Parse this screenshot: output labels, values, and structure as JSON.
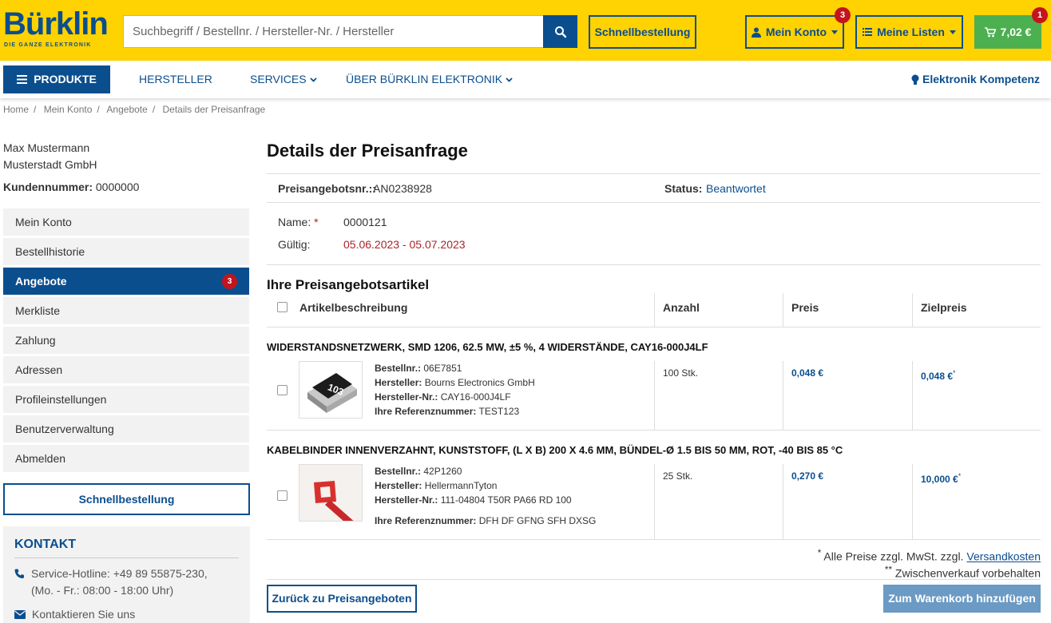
{
  "header": {
    "logo_text": "Bürklin",
    "logo_tagline": "DIE GANZE ELEKTRONIK",
    "search_placeholder": "Suchbegriff / Bestellnr. / Hersteller-Nr. / Hersteller",
    "quick_order": "Schnellbestellung",
    "account": "Mein Konto",
    "account_badge": "3",
    "lists": "Meine Listen",
    "cart_total": "7,02 €",
    "cart_badge": "1"
  },
  "nav": {
    "products": "PRODUKTE",
    "manufacturers": "HERSTELLER",
    "services": "SERVICES",
    "about": "ÜBER BÜRKLIN ELEKTRONIK",
    "competence": "Elektronik Kompetenz"
  },
  "breadcrumb": [
    "Home",
    "Mein Konto",
    "Angebote",
    "Details der Preisanfrage"
  ],
  "sidebar": {
    "name": "Max Mustermann",
    "company": "Musterstadt GmbH",
    "customer_label": "Kundennummer:",
    "customer_number": "0000000",
    "items": [
      {
        "label": "Mein Konto"
      },
      {
        "label": "Bestellhistorie"
      },
      {
        "label": "Angebote",
        "count": "3"
      },
      {
        "label": "Merkliste"
      },
      {
        "label": "Zahlung"
      },
      {
        "label": "Adressen"
      },
      {
        "label": "Profileinstellungen"
      },
      {
        "label": "Benutzerverwaltung"
      },
      {
        "label": "Abmelden"
      }
    ],
    "quick_order": "Schnellbestellung",
    "contact_title": "KONTAKT",
    "hotline": "Service-Hotline: +49 89 55875-230,",
    "hours": "(Mo. - Fr.: 08:00 - 18:00 Uhr)",
    "contact_link": "Kontaktieren Sie uns"
  },
  "main": {
    "title": "Details der Preisanfrage",
    "offer_label": "Preisangebotsnr.::",
    "offer_number": "AN0238928",
    "status_label": "Status:",
    "status_value": "Beantwortet",
    "name_label": "Name:",
    "name_required": "*",
    "name_value": "0000121",
    "valid_label": "Gültig:",
    "valid_value": "05.06.2023 - 05.07.2023",
    "items_title": "Ihre Preisangebotsartikel",
    "columns": {
      "desc": "Artikelbeschreibung",
      "qty": "Anzahl",
      "price": "Preis",
      "target": "Zielpreis"
    },
    "products": [
      {
        "title": "WIDERSTANDSNETZWERK, SMD 1206, 62.5 MW, ±5 %, 4 WIDERSTÄNDE, CAY16-000J4LF",
        "order_label": "Bestellnr.:",
        "order_no": "06E7851",
        "mfr_label": "Hersteller:",
        "mfr": "Bourns Electronics GmbH",
        "mfr_no_label": "Hersteller-Nr.:",
        "mfr_no": "CAY16-000J4LF",
        "ref_label": "Ihre Referenznummer:",
        "ref": "TEST123",
        "qty": "100 Stk.",
        "price": "0,048 €",
        "target": "0,048 €",
        "chip_marking": "103"
      },
      {
        "title": "KABELBINDER INNENVERZAHNT, KUNSTSTOFF, (L X B) 200 X 4.6 MM, BÜNDEL-Ø 1.5 BIS 50 MM, ROT, -40 BIS 85 °C",
        "order_label": "Bestellnr.:",
        "order_no": "42P1260",
        "mfr_label": "Hersteller:",
        "mfr": "HellermannTyton",
        "mfr_no_label": "Hersteller-Nr.:",
        "mfr_no": "111-04804 T50R PA66 RD 100",
        "ref_label": "Ihre Referenznummer:",
        "ref": "DFH DF GFNG SFH DXSG",
        "qty": "25 Stk.",
        "price": "0,270 €",
        "target": "10,000 €"
      }
    ],
    "footnote_star": "*",
    "footnote_1": "Alle Preise zzgl. MwSt. zzgl.",
    "shipping_link": "Versandkosten",
    "footnote_star2": "**",
    "footnote_2": "Zwischenverkauf vorbehalten",
    "back_button": "Zurück zu Preisangeboten",
    "add_to_cart": "Zum Warenkorb hinzufügen"
  },
  "colors": {
    "brand_yellow": "#ffd201",
    "brand_blue": "#0b4e8e",
    "badge_red": "#c4141c",
    "cart_green": "#4caf50"
  }
}
